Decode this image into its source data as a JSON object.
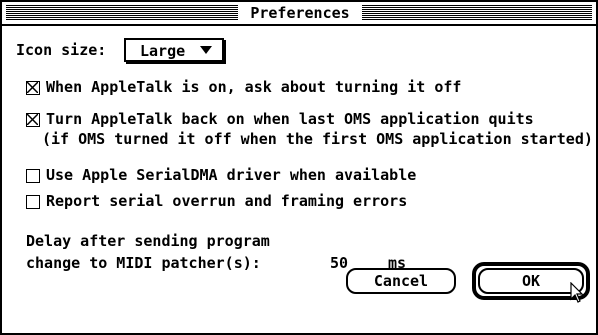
{
  "window": {
    "title": "Preferences"
  },
  "icon_size": {
    "label": "Icon size:",
    "value": "Large"
  },
  "options": [
    {
      "label": "When AppleTalk is on, ask about turning it off",
      "checked": true
    },
    {
      "label": "Turn AppleTalk back on when last OMS application quits",
      "sub": "(if OMS turned it off when the first OMS application started)",
      "checked": true
    },
    {
      "label": "Use Apple SerialDMA driver when available",
      "checked": false
    },
    {
      "label": "Report serial overrun and framing errors",
      "checked": false
    }
  ],
  "delay": {
    "line1": "Delay after sending program",
    "line2": "change to MIDI patcher(s):",
    "value": "50",
    "unit": "ms"
  },
  "buttons": {
    "cancel": "Cancel",
    "ok": "OK"
  }
}
